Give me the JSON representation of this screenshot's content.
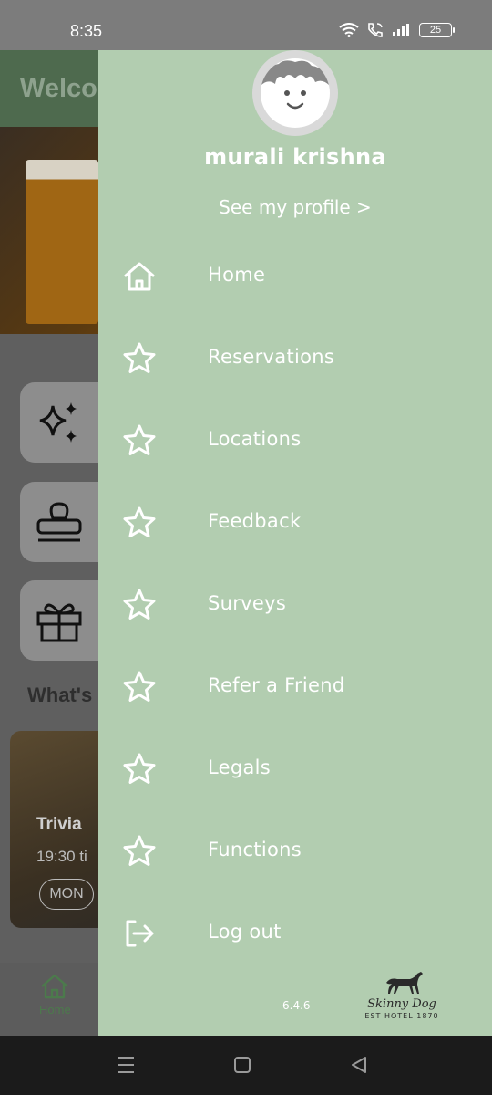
{
  "status_bar": {
    "time": "8:35",
    "battery": "25"
  },
  "background_app": {
    "header_title": "Welco",
    "section_title": "What's",
    "event": {
      "title": "Trivia",
      "time": "19:30 ti",
      "day": "MON"
    },
    "bottom_nav": {
      "home_label": "Home"
    }
  },
  "drawer": {
    "user_name": "murali krishna",
    "see_profile": "See my profile >",
    "menu_items": [
      {
        "label": "Home",
        "icon": "home-icon"
      },
      {
        "label": "Reservations",
        "icon": "star-icon"
      },
      {
        "label": "Locations",
        "icon": "star-icon"
      },
      {
        "label": "Feedback",
        "icon": "star-icon"
      },
      {
        "label": "Surveys",
        "icon": "star-icon"
      },
      {
        "label": "Refer a Friend",
        "icon": "star-icon"
      },
      {
        "label": "Legals",
        "icon": "star-icon"
      },
      {
        "label": "Functions",
        "icon": "star-icon"
      },
      {
        "label": "Log out",
        "icon": "logout-icon"
      }
    ],
    "version": "6.4.6",
    "logo": {
      "name": "Skinny Dog",
      "sub": "EST HOTEL 1870"
    }
  },
  "colors": {
    "drawer_bg": "#b2cdb0",
    "overlay": "#5f5f5f",
    "text": "#ffffff"
  }
}
